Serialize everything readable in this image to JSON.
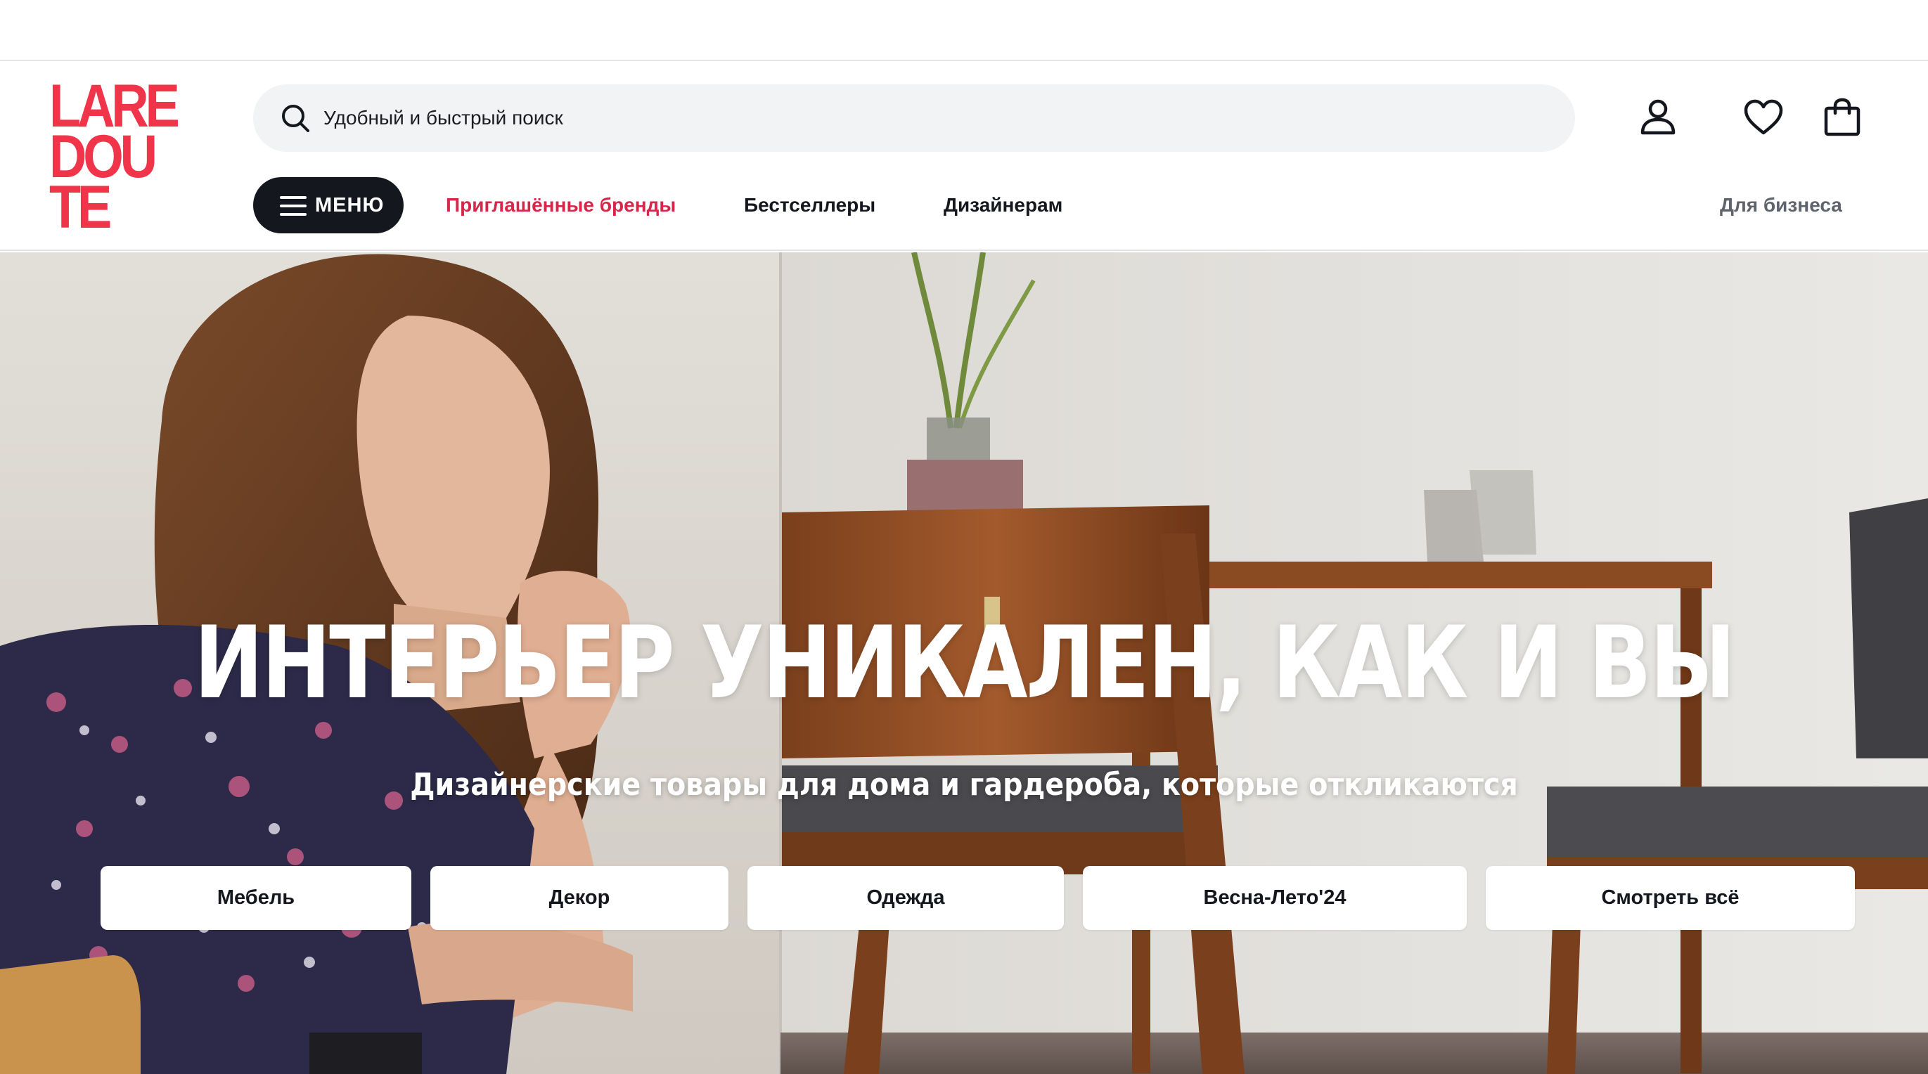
{
  "logo": {
    "line1": "LARE",
    "line2": "DOU",
    "line3": "TE",
    "color": "#f0344a"
  },
  "search": {
    "placeholder": "Удобный и быстрый поиск",
    "icon": "search-icon"
  },
  "header_icons": [
    "account-icon",
    "heart-icon",
    "shopping-bag-icon"
  ],
  "nav": {
    "menu_label": "МЕНЮ",
    "links": [
      {
        "label": "Приглашённые бренды",
        "color": "#d6264a"
      },
      {
        "label": "Бестселлеры"
      },
      {
        "label": "Дизайнерам"
      }
    ],
    "business_label": "Для бизнеса"
  },
  "hero": {
    "title": "ИНТЕРЬЕР УНИКАЛЕН, КАК И ВЫ",
    "subtitle": "Дизайнерские товары для дома и гардероба, которые откликаются",
    "categories": [
      {
        "label": "Мебель"
      },
      {
        "label": "Декор"
      },
      {
        "label": "Одежда"
      },
      {
        "label": "Весна-Лето'24"
      },
      {
        "label": "Смотреть всё"
      }
    ]
  }
}
